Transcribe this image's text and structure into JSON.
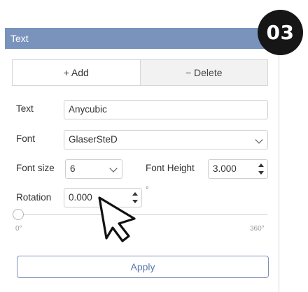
{
  "panel": {
    "title": "Text"
  },
  "step_badge": "03",
  "actions": {
    "add": "+ Add",
    "delete": "− Delete"
  },
  "text_field": {
    "label": "Text",
    "value": "Anycubic"
  },
  "font_field": {
    "label": "Font",
    "value": "GlaserSteD"
  },
  "font_size": {
    "label": "Font size",
    "value": "6"
  },
  "font_height": {
    "label": "Font Height",
    "value": "3.000"
  },
  "rotation": {
    "label": "Rotation",
    "value": "0.000",
    "unit": "°",
    "slider_min": "0°",
    "slider_max": "360°",
    "slider_fraction": 0
  },
  "apply_label": "Apply",
  "colors": {
    "header": "#7a93bd",
    "badge": "#161616",
    "apply_text": "#5a78ad"
  },
  "icons": {
    "dropdown": "chevron-down-icon",
    "spinner": "spin-arrows-icon",
    "cursor": "mouse-pointer-icon"
  }
}
